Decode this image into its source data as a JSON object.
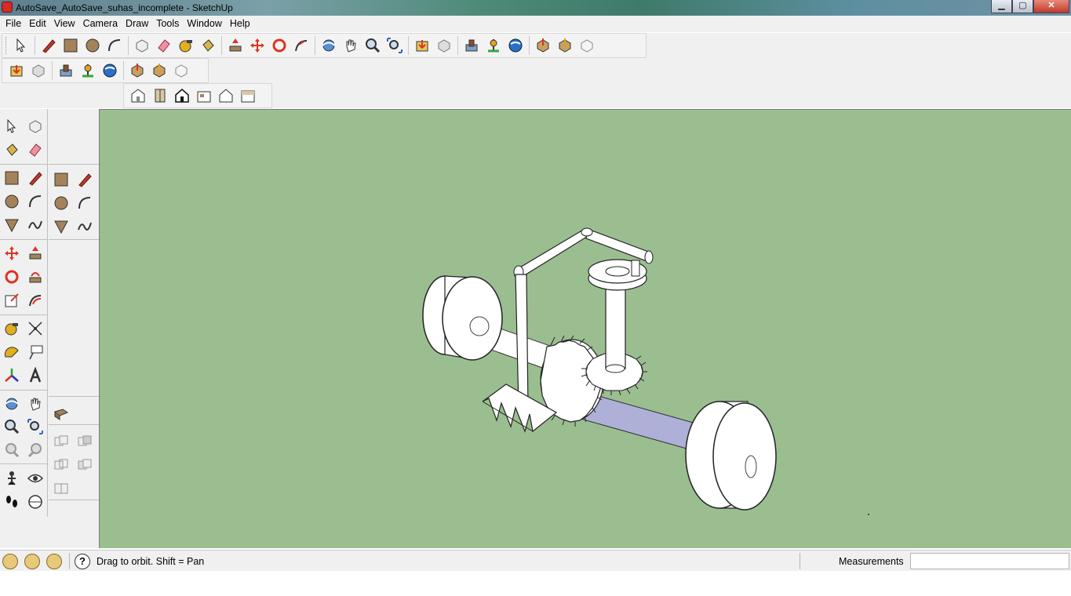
{
  "window": {
    "title": "AutoSave_AutoSave_suhas_incomplete - SketchUp",
    "minimize": "▁",
    "maximize": "▢",
    "close": "✕"
  },
  "menu": [
    "File",
    "Edit",
    "View",
    "Camera",
    "Draw",
    "Tools",
    "Window",
    "Help"
  ],
  "status": {
    "hint": "Drag to orbit.  Shift = Pan",
    "help": "?",
    "measurements_label": "Measurements",
    "measurements_value": ""
  },
  "colors": {
    "viewport_bg": "#9bbe90",
    "axle_blue": "#aeb0d8",
    "model_white": "#ffffff"
  }
}
